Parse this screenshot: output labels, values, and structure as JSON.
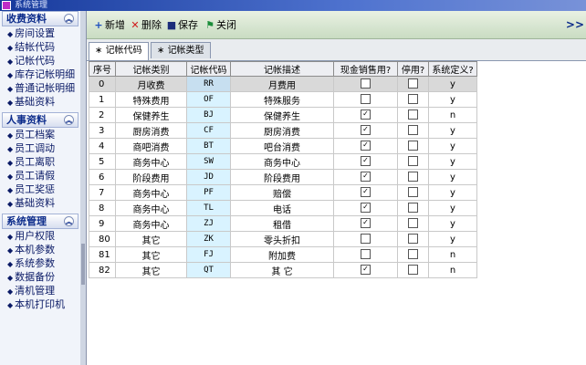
{
  "window": {
    "title": "系统管理"
  },
  "sidebar": {
    "sections": [
      {
        "title": "收费资料",
        "items": [
          "房间设置",
          "结帐代码",
          "记帐代码",
          "库存记帐明细",
          "普通记帐明细",
          "基础资料"
        ]
      },
      {
        "title": "人事资料",
        "items": [
          "员工档案",
          "员工调动",
          "员工离职",
          "员工请假",
          "员工奖惩",
          "基础资料"
        ]
      },
      {
        "title": "系统管理",
        "items": [
          "用户权限",
          "本机参数",
          "系统参数",
          "数据备份",
          "清机管理",
          "本机打印机"
        ]
      }
    ],
    "toggle_icon": "double-chevron-up-icon"
  },
  "toolbar": {
    "add": "新增",
    "delete": "删除",
    "save": "保存",
    "close": "关闭",
    "more": ">>"
  },
  "tabs": [
    "记帐代码",
    "记帐类型"
  ],
  "table": {
    "columns": [
      "序号",
      "记帐类别",
      "记帐代码",
      "记帐描述",
      "现金销售用?",
      "停用?",
      "系统定义?"
    ],
    "rows": [
      {
        "idx": "0",
        "category": "月收费",
        "code": "RR",
        "desc": "月费用",
        "cash": false,
        "disabled": false,
        "sysdef": "y"
      },
      {
        "idx": "1",
        "category": "特殊费用",
        "code": "OF",
        "desc": "特殊服务",
        "cash": false,
        "disabled": false,
        "sysdef": "y"
      },
      {
        "idx": "2",
        "category": "保健养生",
        "code": "BJ",
        "desc": "保健养生",
        "cash": true,
        "disabled": false,
        "sysdef": "n"
      },
      {
        "idx": "3",
        "category": "厨房消费",
        "code": "CF",
        "desc": "厨房消费",
        "cash": true,
        "disabled": false,
        "sysdef": "y"
      },
      {
        "idx": "4",
        "category": "商吧消费",
        "code": "BT",
        "desc": "吧台消费",
        "cash": true,
        "disabled": false,
        "sysdef": "y"
      },
      {
        "idx": "5",
        "category": "商务中心",
        "code": "SW",
        "desc": "商务中心",
        "cash": true,
        "disabled": false,
        "sysdef": "y"
      },
      {
        "idx": "6",
        "category": "阶段费用",
        "code": "JD",
        "desc": "阶段费用",
        "cash": true,
        "disabled": false,
        "sysdef": "y"
      },
      {
        "idx": "7",
        "category": "商务中心",
        "code": "PF",
        "desc": "赔偿",
        "cash": true,
        "disabled": false,
        "sysdef": "y"
      },
      {
        "idx": "8",
        "category": "商务中心",
        "code": "TL",
        "desc": "电话",
        "cash": true,
        "disabled": false,
        "sysdef": "y"
      },
      {
        "idx": "9",
        "category": "商务中心",
        "code": "ZJ",
        "desc": "租借",
        "cash": true,
        "disabled": false,
        "sysdef": "y"
      },
      {
        "idx": "80",
        "category": "其它",
        "code": "ZK",
        "desc": "零头折扣",
        "cash": false,
        "disabled": false,
        "sysdef": "y"
      },
      {
        "idx": "81",
        "category": "其它",
        "code": "FJ",
        "desc": "附加费",
        "cash": false,
        "disabled": false,
        "sysdef": "n"
      },
      {
        "idx": "82",
        "category": "其它",
        "code": "QT",
        "desc": "其  它",
        "cash": true,
        "disabled": false,
        "sysdef": "n"
      }
    ]
  },
  "colors": {
    "accent": "#0b2b8a",
    "toolbar_bg": "#d6e6cf",
    "code_col_bg": "#d9f3ff",
    "selected_row": "#d9d9d9"
  }
}
